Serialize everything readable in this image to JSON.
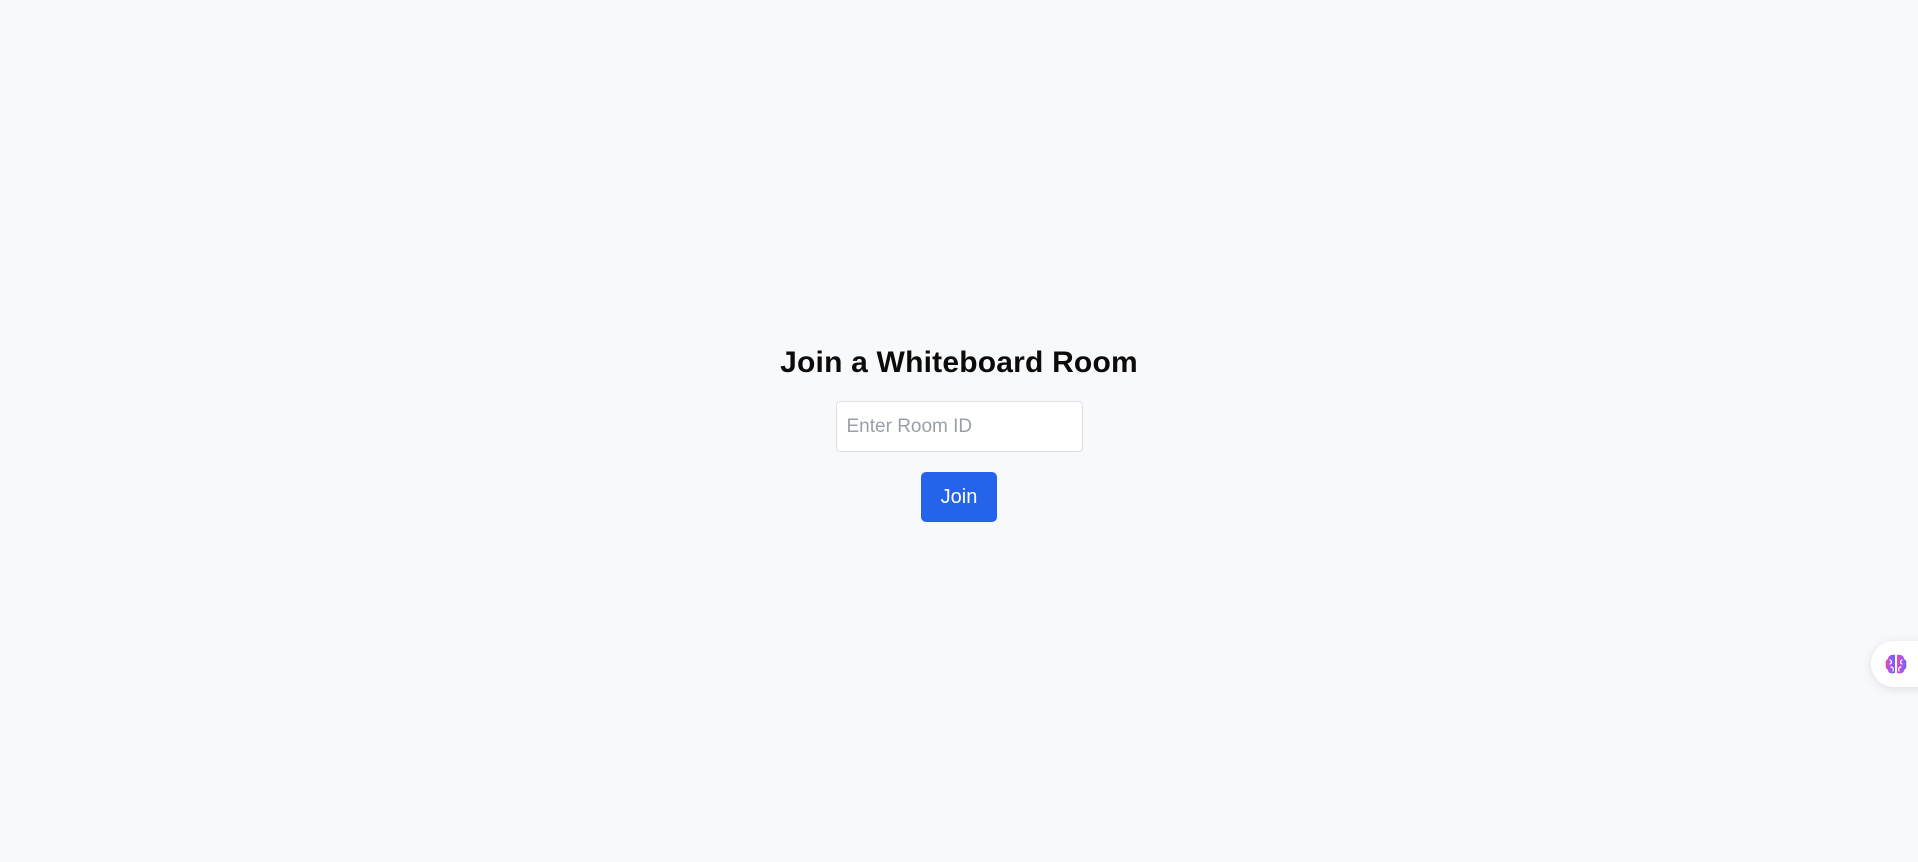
{
  "join": {
    "title": "Join a Whiteboard Room",
    "room_input": {
      "placeholder": "Enter Room ID",
      "value": ""
    },
    "join_label": "Join"
  },
  "assistant_widget": {
    "icon": "brain-icon"
  },
  "colors": {
    "background": "#f8f9fb",
    "accent": "#2563eb",
    "brain_left": "#ec4899",
    "brain_right": "#6366f1"
  }
}
